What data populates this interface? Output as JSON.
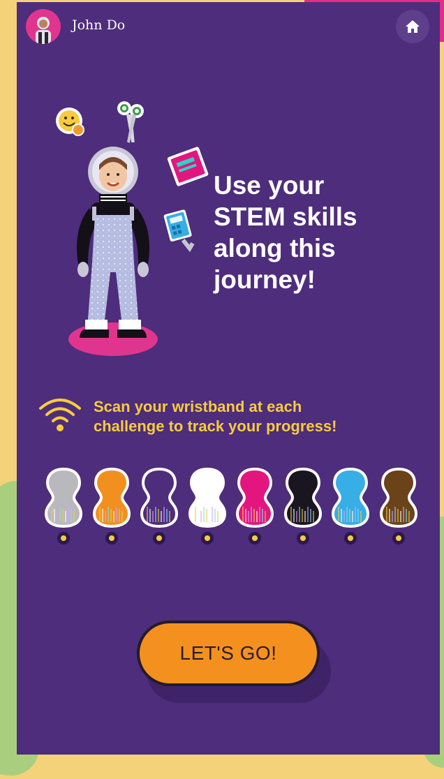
{
  "header": {
    "username": "John Do",
    "home_icon": "home-icon"
  },
  "hero": {
    "headline_lines": [
      "Use your",
      "STEM skills",
      "along this",
      "journey!"
    ],
    "stickers": [
      "smiley-face-sticker",
      "scissors-sticker",
      "notebook-sticker",
      "calculator-sticker"
    ]
  },
  "scan": {
    "icon": "wireless-scan-icon",
    "lines": [
      "Scan your wristband at each",
      "challenge to track your progress!"
    ]
  },
  "tokens": [
    {
      "name": "token-gray",
      "color": "#b9b8bd"
    },
    {
      "name": "token-orange",
      "color": "#f1901f"
    },
    {
      "name": "token-outline-purple",
      "color": "#4d2d7c"
    },
    {
      "name": "token-white",
      "color": "#ffffff"
    },
    {
      "name": "token-pink",
      "color": "#e3167f"
    },
    {
      "name": "token-black",
      "color": "#1a1620"
    },
    {
      "name": "token-blue",
      "color": "#37aee5"
    },
    {
      "name": "token-brown",
      "color": "#6b4318"
    }
  ],
  "cta": {
    "label": "LET'S GO!"
  },
  "colors": {
    "background": "#4d2d7c",
    "accent_yellow": "#f7cc3c",
    "button_orange": "#f4911e",
    "pink": "#e0358f"
  }
}
